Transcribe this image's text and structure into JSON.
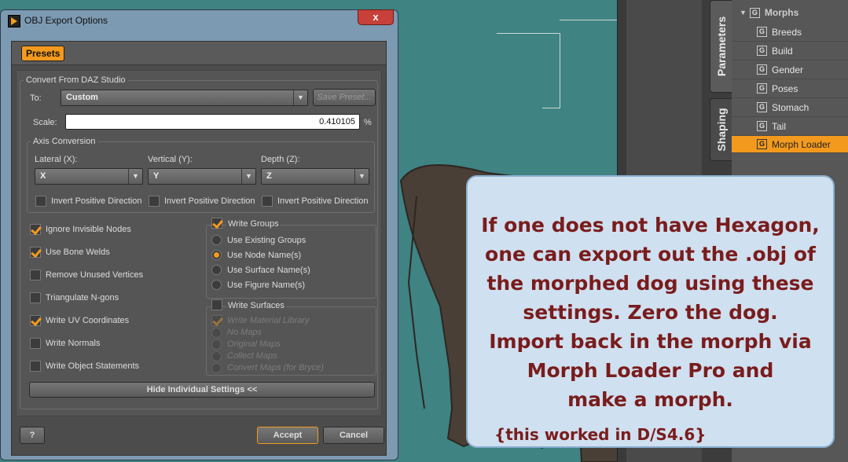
{
  "dialog": {
    "title": "OBJ Export Options",
    "close_glyph": "x",
    "presets_tab": "Presets",
    "convert_group": "Convert From DAZ Studio",
    "to_label": "To:",
    "to_value": "Custom",
    "save_preset": "Save Preset...",
    "scale_label": "Scale:",
    "scale_value": "0.410105",
    "scale_unit": "%",
    "axis_group": "Axis Conversion",
    "lateral_label": "Lateral (X):",
    "lateral_value": "X",
    "vertical_label": "Vertical (Y):",
    "vertical_value": "Y",
    "depth_label": "Depth (Z):",
    "depth_value": "Z",
    "invert_label": "Invert Positive Direction",
    "options": [
      {
        "label": "Ignore Invisible Nodes",
        "checked": true
      },
      {
        "label": "Use Bone Welds",
        "checked": true
      },
      {
        "label": "Remove Unused Vertices",
        "checked": false
      },
      {
        "label": "Triangulate N-gons",
        "checked": false
      },
      {
        "label": "Write UV Coordinates",
        "checked": true
      },
      {
        "label": "Write Normals",
        "checked": false
      },
      {
        "label": "Write Object Statements",
        "checked": false
      }
    ],
    "write_groups": "Write Groups",
    "group_options": [
      "Use Existing Groups",
      "Use Node Name(s)",
      "Use Surface Name(s)",
      "Use Figure Name(s)"
    ],
    "group_selected": 1,
    "write_surfaces": "Write Surfaces",
    "surface_options": [
      "Write Material Library",
      "No Maps",
      "Original Maps",
      "Collect Maps",
      "Convert Maps (for Bryce)"
    ],
    "hide_settings": "Hide Individual Settings <<",
    "help": "?",
    "accept": "Accept",
    "cancel": "Cancel"
  },
  "side_tabs": [
    "Parameters",
    "Shaping"
  ],
  "tree": {
    "header": "Morphs",
    "items": [
      "Breeds",
      "Build",
      "Gender",
      "Poses",
      "Stomach",
      "Tail",
      "Morph Loader"
    ],
    "selected": "Morph Loader",
    "group_glyph": "G",
    "expand_glyph": "▼"
  },
  "callout": {
    "lines": [
      "If one does not have Hexagon,",
      "one can export out the .obj of",
      "the morphed dog using these",
      "settings. Zero the dog.",
      "Import back in the morph via",
      "Morph Loader Pro and",
      "make a morph."
    ],
    "note": "{this worked in D/S4.6}"
  },
  "colors": {
    "accent": "#f39a1e",
    "callout_text": "#7a1c1c",
    "viewport": "#3f8383"
  }
}
